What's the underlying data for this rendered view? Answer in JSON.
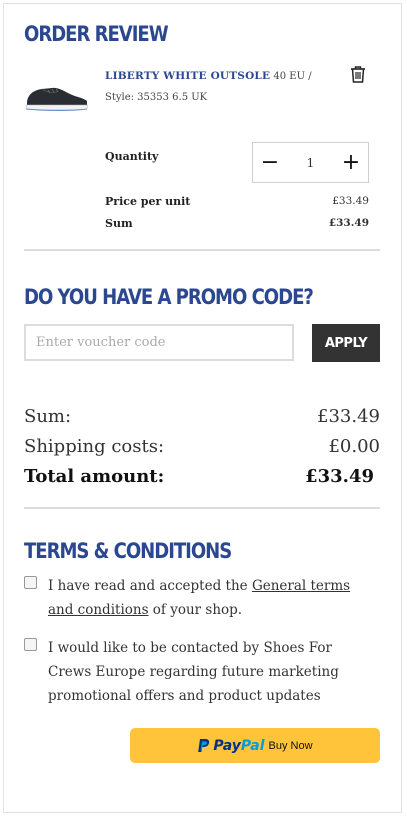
{
  "order_review": {
    "title": "ORDER REVIEW",
    "product": {
      "name": "LIBERTY WHITE OUTSOLE",
      "details": " 40 EU / Style: 35353 6.5 UK"
    },
    "quantity_label": "Quantity",
    "quantity": "1",
    "minus_symbol": "−",
    "plus_symbol": "+",
    "price_per_unit_label": "Price per unit",
    "price_per_unit": "£33.49",
    "sum_label": "Sum",
    "sum": "£33.49",
    "icons": {
      "product_image": "shoe-image",
      "delete": "trash-icon"
    }
  },
  "promo": {
    "title": "DO YOU HAVE A PROMO CODE?",
    "voucher_placeholder": "Enter voucher code",
    "voucher_value": "",
    "apply_label": "APPLY"
  },
  "totals": {
    "sum_label": "Sum:",
    "sum_value": "£33.49",
    "shipping_label": "Shipping costs:",
    "shipping_value": "£0.00",
    "total_label": "Total amount:",
    "total_value": "£33.49"
  },
  "terms": {
    "title": "TERMS & CONDITIONS",
    "accept_prefix": "I have read and accepted the ",
    "accept_link": "General terms and conditions",
    "accept_suffix": " of your shop.",
    "accept_checked": false,
    "marketing_text": "I would like to be contacted by Shoes For Crews Europe regarding future marketing promotional offers and product updates",
    "marketing_checked": false
  },
  "paypal": {
    "brand_part1": "Pay",
    "brand_part2": "Pal",
    "suffix": "Buy Now",
    "button_color": "#ffc439"
  },
  "colors": {
    "heading": "#2b4790",
    "apply_button": "#333333",
    "divider": "#dcdcdc"
  }
}
